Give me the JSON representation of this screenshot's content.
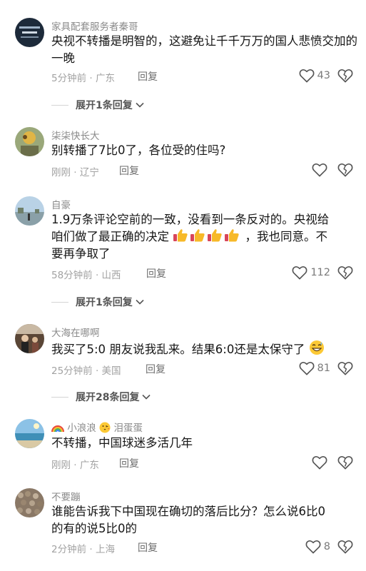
{
  "comments": [
    {
      "username": "家具配套服务者秦哥",
      "text": "央视不转播是明智的，这避免让千千万万的国人悲愤交加的一晚",
      "time": "5分钟前 · 广东",
      "reply": "回复",
      "likes": "43",
      "expand": "展开1条回复"
    },
    {
      "username": "柒柒快长大",
      "text": "别转播了7比0了，各位受的住吗?",
      "time": "刚刚 · 辽宁",
      "reply": "回复",
      "likes": ""
    },
    {
      "username": "自豪",
      "text_line1": "1.9万条评论空前的一致，没看到一条反对的。央视给",
      "text_line2a": "咱们做了最正确的决定",
      "text_line2b": "，我也同意。不",
      "text_line3": "要再争取了",
      "emoji": "thumbs-up-icon",
      "time": "58分钟前 · 山西",
      "reply": "回复",
      "likes": "112",
      "expand": "展开1条回复"
    },
    {
      "username": "大海在哪啊",
      "text": "我买了5:0 朋友说我乱来。结果6:0还是太保守了",
      "emoji": "grin-sweat-icon",
      "time": "25分钟前 · 美国",
      "reply": "回复",
      "likes": "81",
      "expand": "展开28条回复"
    },
    {
      "username_a": "小浪浪",
      "username_b": "泪蛋蛋",
      "username_icon": "rainbow-icon",
      "username_icon2": "kiss-face-icon",
      "text": "不转播，中国球迷多活几年",
      "time": "刚刚 · 广东",
      "reply": "回复",
      "likes": ""
    },
    {
      "username": "不要蹦",
      "text_line1": "谁能告诉我下中国现在确切的落后比分？怎么说6比0",
      "text_line2": "的有的说5比0的",
      "time": "2分钟前 · 上海",
      "reply": "回复",
      "likes": "8"
    }
  ],
  "colors": {
    "text": "#161616",
    "meta": "#a2a2a2",
    "username": "#8a8a8a"
  }
}
